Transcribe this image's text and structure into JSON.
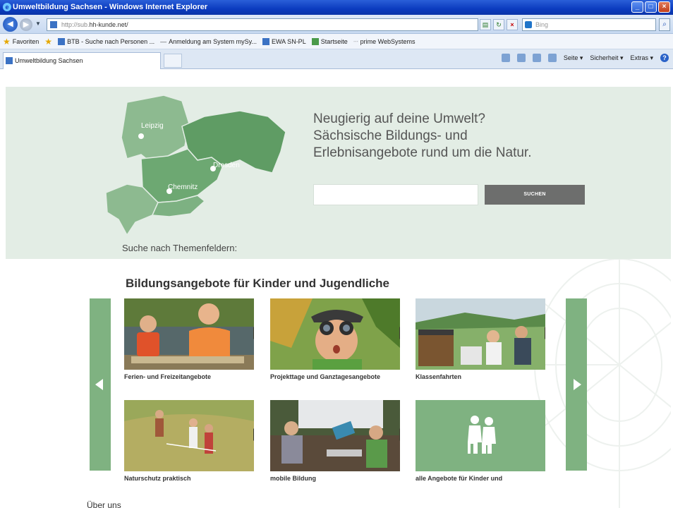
{
  "browser": {
    "title": "Umweltbildung Sachsen - Windows Internet Explorer",
    "url_prefix": "http://sub.",
    "url_domain": "hh-kunde.net/",
    "search_placeholder": "Bing",
    "favorites_label": "Favoriten",
    "favorites": [
      "BTB - Suche nach Personen ...",
      "Anmeldung am System mySy...",
      "EWA SN-PL",
      "Startseite",
      "prime WebSystems"
    ],
    "tab_title": "Umweltbildung Sachsen",
    "commands": [
      "Seite ▾",
      "Sicherheit ▾",
      "Extras ▾"
    ]
  },
  "hero": {
    "map_cities": [
      "Leipzig",
      "Dresden",
      "Chemnitz"
    ],
    "headline_lines": [
      "Neugierig auf deine Umwelt?",
      "Sächsische Bildungs- und",
      "Erlebnisangebote rund um die Natur."
    ],
    "search_button": "SUCHEN",
    "search_value": "",
    "topic_label": "Suche nach Themenfeldern:"
  },
  "section": {
    "title": "Bildungsangebote für Kinder und Jugendliche",
    "cards": [
      {
        "label": "Ferien- und Freizeitangebote",
        "icon": "kids-canoe-photo"
      },
      {
        "label": "Projekttage und Ganztagesangebote",
        "icon": "binoculars-child-photo"
      },
      {
        "label": "Klassenfahrten",
        "icon": "class-trip-photo"
      },
      {
        "label": "Naturschutz praktisch",
        "icon": "meadow-work-photo"
      },
      {
        "label": "mobile Bildung",
        "icon": "mobile-lab-photo"
      },
      {
        "label": "alle Angebote für Kinder und",
        "icon": "children-icon"
      }
    ]
  },
  "footer": {
    "about": "Über uns"
  },
  "colors": {
    "accent_green": "#7fb281",
    "hero_bg": "#e3ede5",
    "button_grey": "#6d6e6d"
  }
}
